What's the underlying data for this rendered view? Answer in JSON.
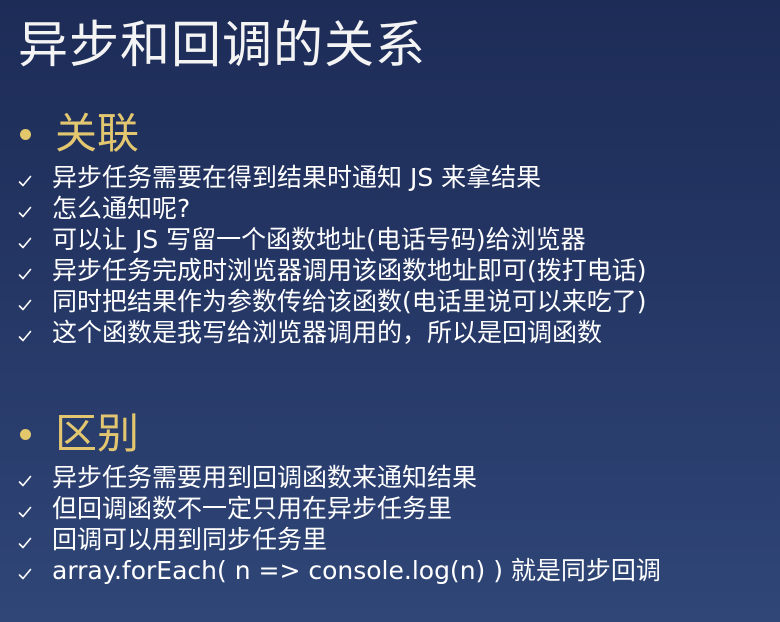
{
  "title": "异步和回调的关系",
  "sections": [
    {
      "heading": "关联",
      "items": [
        "异步任务需要在得到结果时通知 JS 来拿结果",
        "怎么通知呢?",
        "可以让 JS 写留一个函数地址(电话号码)给浏览器",
        "异步任务完成时浏览器调用该函数地址即可(拨打电话)",
        "同时把结果作为参数传给该函数(电话里说可以来吃了)",
        "这个函数是我写给浏览器调用的，所以是回调函数"
      ]
    },
    {
      "heading": "区别",
      "items": [
        "异步任务需要用到回调函数来通知结果",
        "但回调函数不一定只用在异步任务里",
        "回调可以用到同步任务里",
        "array.forEach( n => console.log(n) ) 就是同步回调"
      ]
    }
  ],
  "colors": {
    "heading": "#e3c770",
    "bullet": "#e2c86a",
    "text": "#ffffff",
    "background": "#243563"
  },
  "icons": {
    "section_bullet": "dot-bullet-icon",
    "item_bullet": "checkmark-icon"
  }
}
